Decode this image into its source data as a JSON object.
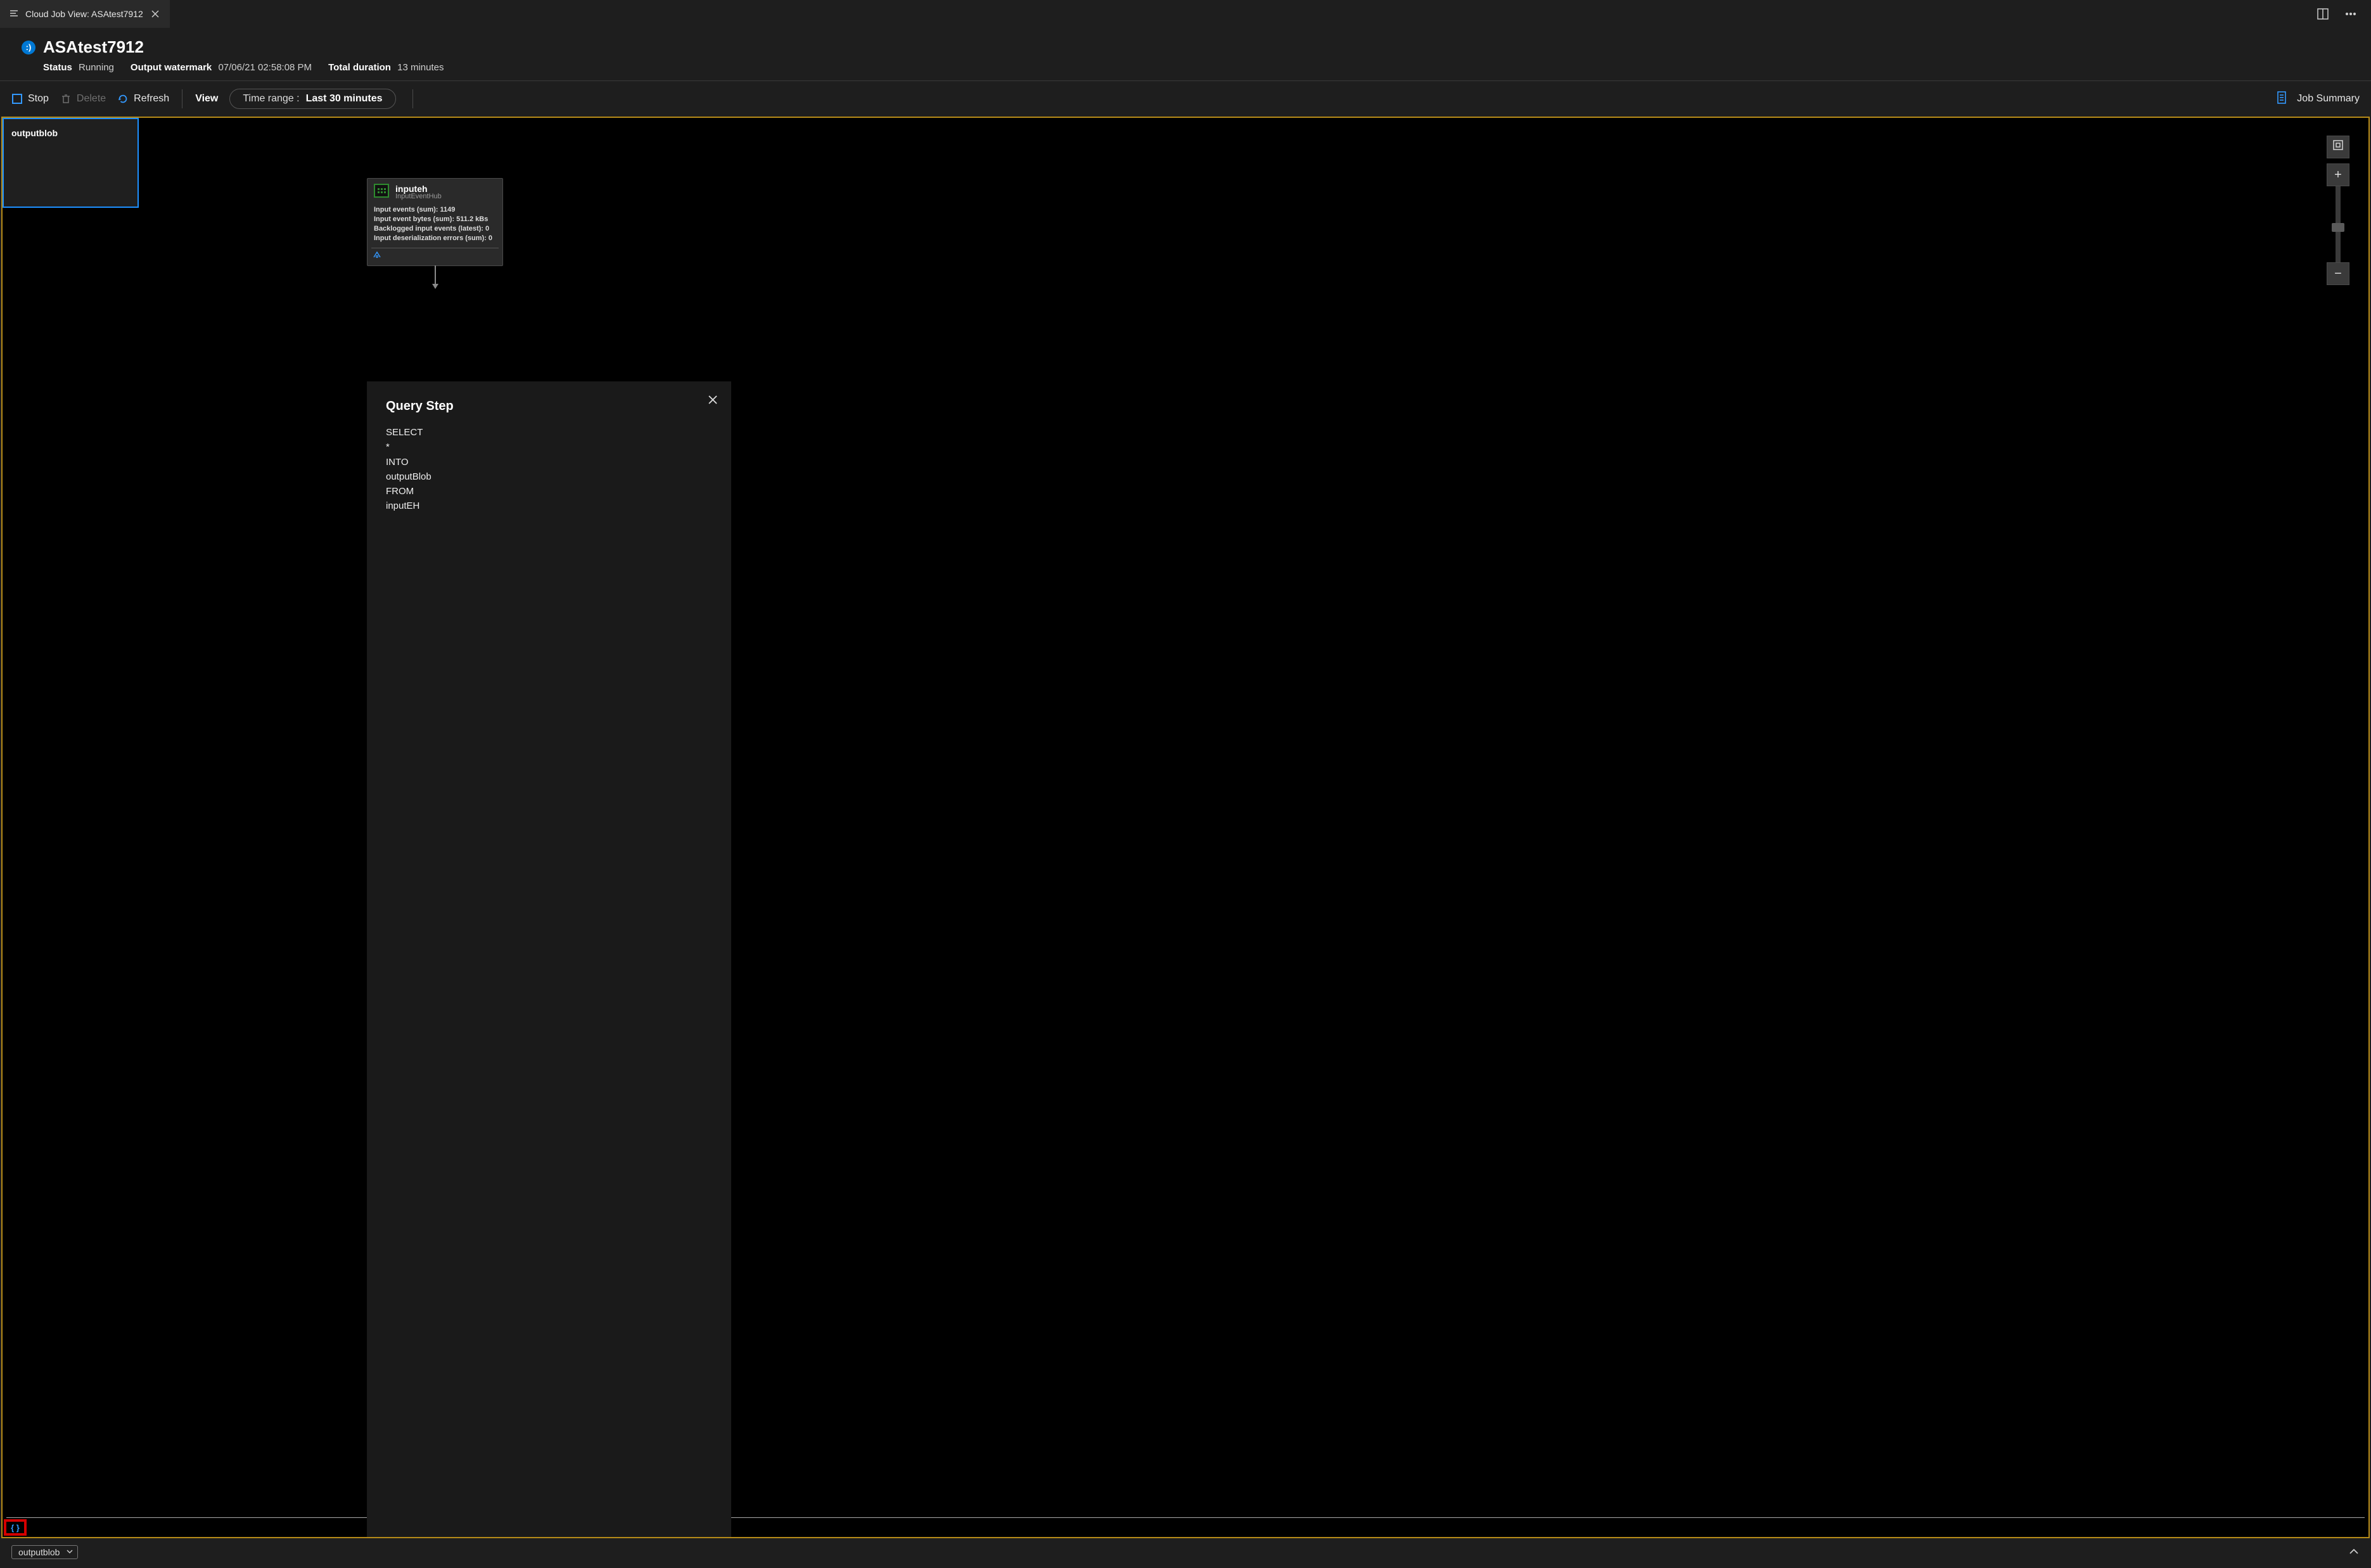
{
  "tab": {
    "title": "Cloud Job View: ASAtest7912"
  },
  "header": {
    "job_name": "ASAtest7912",
    "status_label": "Status",
    "status_value": "Running",
    "watermark_label": "Output watermark",
    "watermark_value": "07/06/21 02:58:08 PM",
    "duration_label": "Total duration",
    "duration_value": "13 minutes"
  },
  "toolbar": {
    "stop": "Stop",
    "delete": "Delete",
    "refresh": "Refresh",
    "view": "View",
    "time_range_label": "Time range :",
    "time_range_value": "Last 30 minutes",
    "job_summary": "Job Summary"
  },
  "diagram": {
    "input_node": {
      "title": "inputeh",
      "subtitle": "InputEventHub",
      "metrics": [
        "Input events (sum): 1149",
        "Input event bytes (sum): 511.2 kBs",
        "Backlogged input events (latest): 0",
        "Input deserialization errors (sum): 0"
      ]
    },
    "output_node": {
      "title": "outputblob",
      "script_symbol": "{ }"
    }
  },
  "query_popup": {
    "title": "Query Step",
    "lines": [
      "SELECT",
      "*",
      "INTO",
      "outputBlob",
      "FROM",
      "inputEH"
    ]
  },
  "bottom": {
    "selector": "outputblob"
  }
}
